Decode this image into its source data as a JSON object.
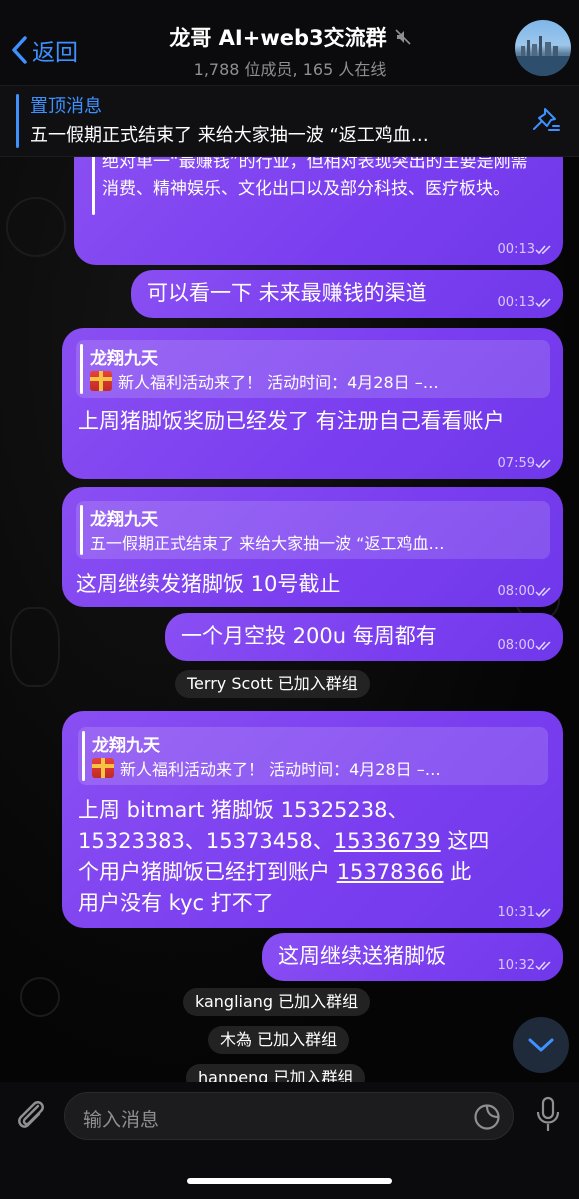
{
  "header": {
    "back_label": "返回",
    "title": "龙哥 AI+web3交流群",
    "subtitle": "1,788 位成员, 165 人在线"
  },
  "pinned": {
    "title": "置顶消息",
    "text": "五一假期正式结束了 来给大家抽一波 “返工鸡血…"
  },
  "messages": {
    "m1": {
      "text": "绝对单一“最赚钱”的行业，但相对表现突出的主要是刚需消费、精神娱乐、文化出口以及部分科技、医疗板块。",
      "time": "00:13"
    },
    "m2": {
      "text": "可以看一下 未来最赚钱的渠道",
      "time": "00:13"
    },
    "m3": {
      "reply_name": "龙翔九天",
      "reply_text": "新人福利活动来了！ 活动时间：4月28日 –…",
      "text": "上周猪脚饭奖励已经发了 有注册自己看看账户",
      "time": "07:59"
    },
    "m4": {
      "reply_name": "龙翔九天",
      "reply_text": "五一假期正式结束了 来给大家抽一波 “返工鸡血…",
      "text": "这周继续发猪脚饭 10号截止",
      "time": "08:00"
    },
    "m5": {
      "text": "一个月空投 200u 每周都有",
      "time": "08:00"
    },
    "m6": {
      "reply_name": "龙翔九天",
      "reply_text": "新人福利活动来了！ 活动时间：4月28日 –…",
      "line1": "上周 bitmart 猪脚饭 15325238、",
      "line2a": "15323383、15373458、",
      "line2b": "15336739",
      "line2c": " 这四",
      "line3a": "个用户猪脚饭已经打到账户 ",
      "line3b": "15378366",
      "line3c": " 此",
      "line4": "用户没有 kyc 打不了",
      "time": "10:31"
    },
    "m7": {
      "text": "这周继续送猪脚饭",
      "time": "10:32"
    }
  },
  "service": {
    "s1": "Terry Scott 已加入群组",
    "s2": "kangliang 已加入群组",
    "s3": "木為 已加入群组",
    "s4": "hanpeng 已加入群组"
  },
  "input": {
    "placeholder": "输入消息"
  },
  "colors": {
    "accent": "#3e91ff",
    "bubble": "#7a3ef0"
  }
}
